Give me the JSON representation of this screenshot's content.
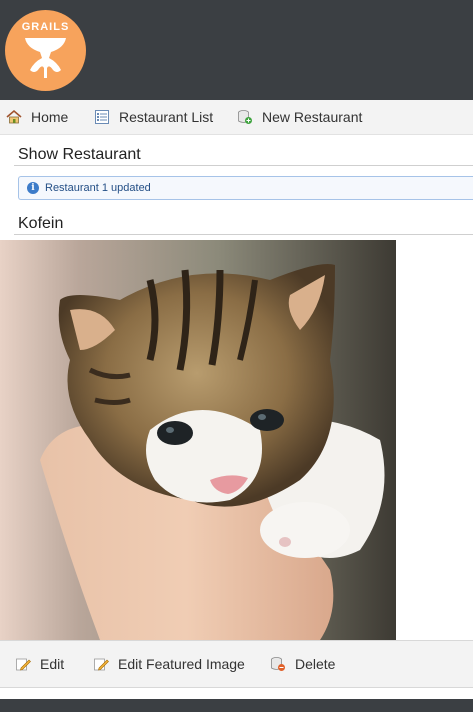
{
  "app": {
    "logo_text": "GRAILS"
  },
  "nav": {
    "home_label": "Home",
    "list_label": "Restaurant List",
    "new_label": "New Restaurant"
  },
  "page": {
    "title": "Show Restaurant",
    "message": "Restaurant 1 updated",
    "restaurant_name": "Kofein"
  },
  "buttons": {
    "edit_label": "Edit",
    "edit_image_label": "Edit Featured Image",
    "delete_label": "Delete"
  },
  "colors": {
    "header_bg": "#3b3f43",
    "logo_orange": "#f7a35c",
    "message_border": "#a6c3e8"
  },
  "icons": {
    "home": "house-icon",
    "list": "list-icon",
    "new": "add-database-icon",
    "message": "info-icon",
    "edit": "pencil-icon",
    "edit_image": "pencil-icon",
    "delete": "delete-database-icon"
  }
}
